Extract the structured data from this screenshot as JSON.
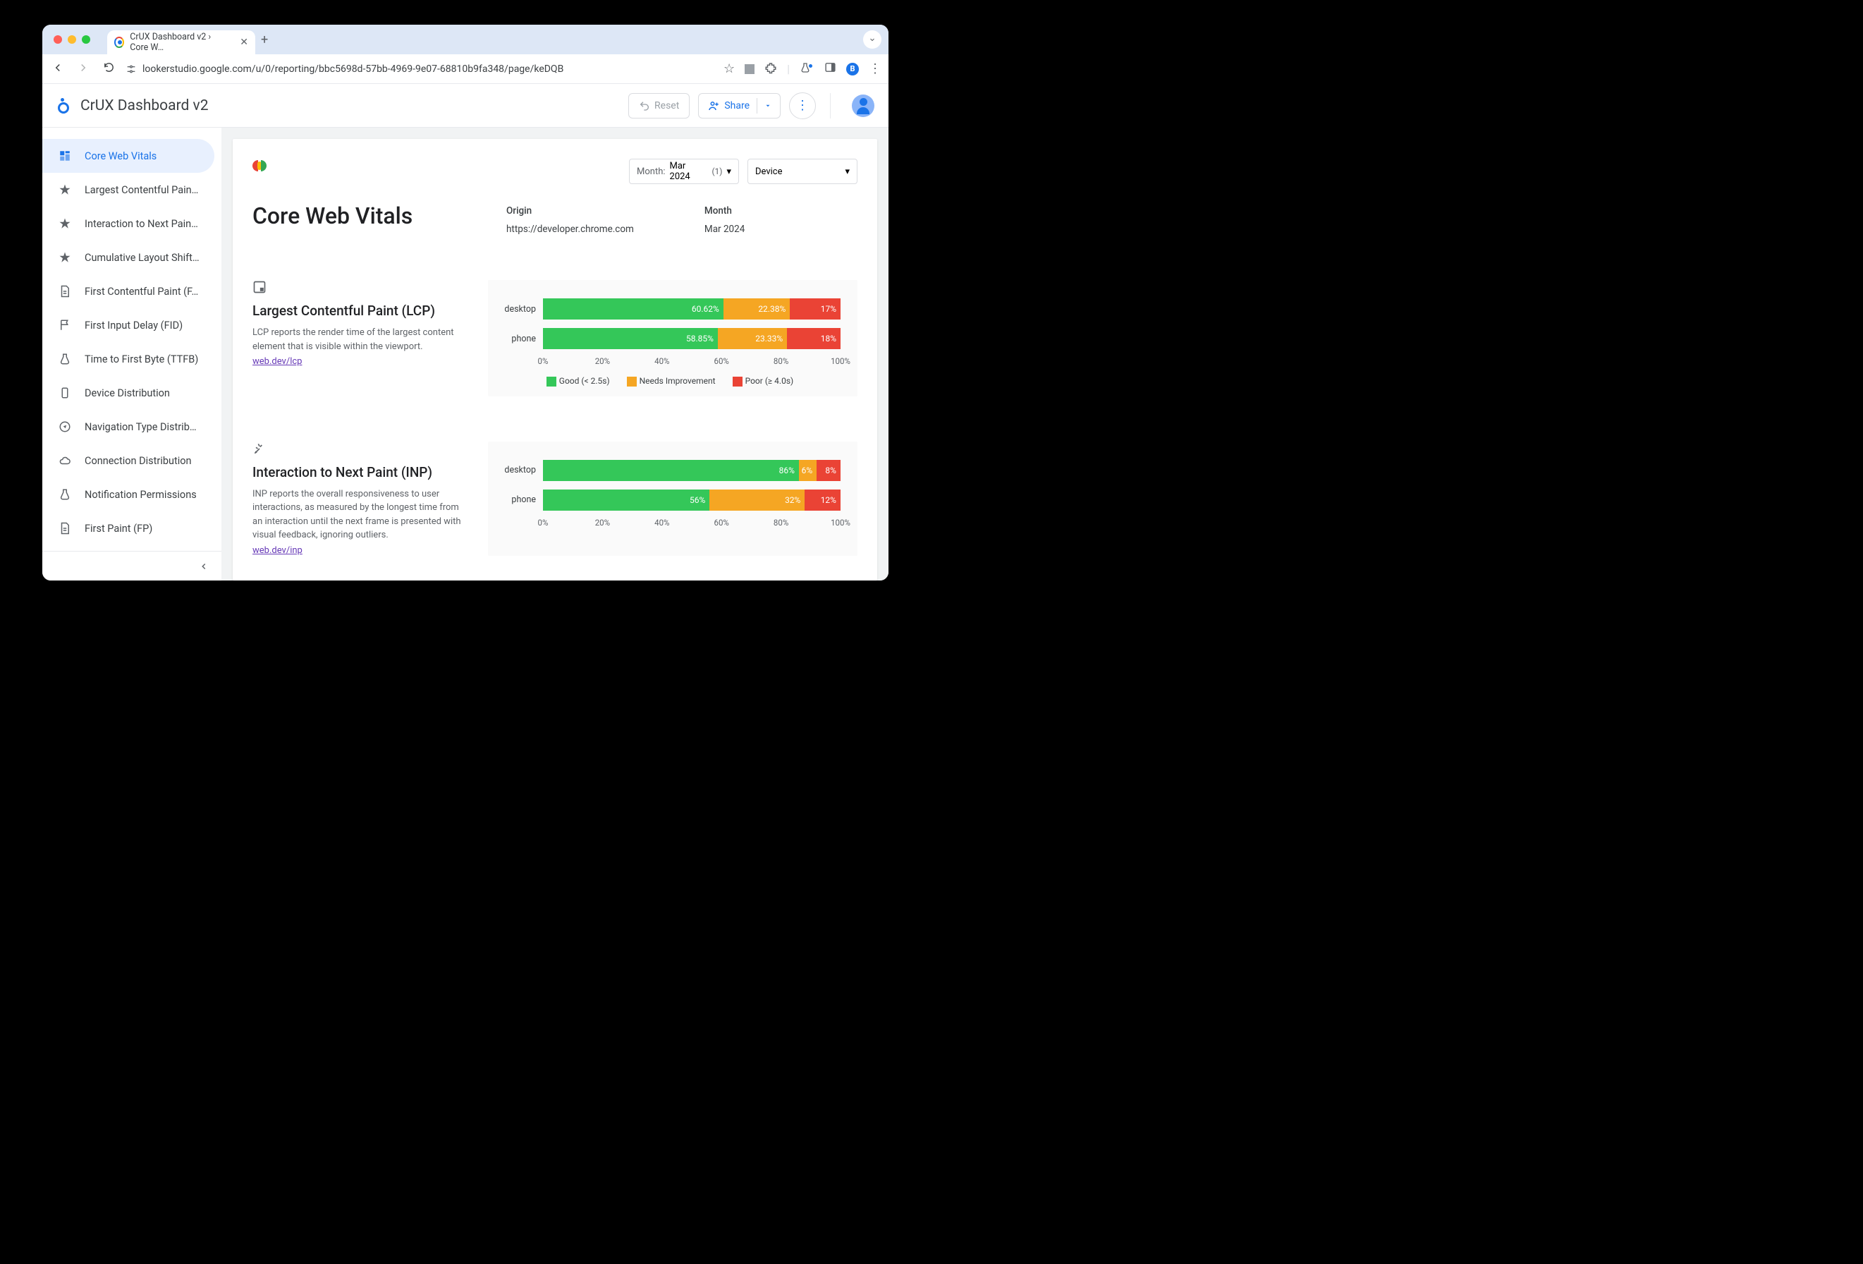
{
  "browser": {
    "tab_title": "CrUX Dashboard v2 › Core W…",
    "url": "lookerstudio.google.com/u/0/reporting/bbc5698d-57bb-4969-9e07-68810b9fa348/page/keDQB",
    "avatar_letter": "B"
  },
  "app": {
    "title": "CrUX Dashboard v2",
    "reset": "Reset",
    "share": "Share"
  },
  "sidebar": {
    "items": [
      {
        "label": "Core Web Vitals",
        "icon": "dashboard",
        "active": true
      },
      {
        "label": "Largest Contentful Pain…",
        "icon": "star"
      },
      {
        "label": "Interaction to Next Pain…",
        "icon": "star"
      },
      {
        "label": "Cumulative Layout Shift…",
        "icon": "star"
      },
      {
        "label": "First Contentful Paint (F…",
        "icon": "doc"
      },
      {
        "label": "First Input Delay (FID)",
        "icon": "flag"
      },
      {
        "label": "Time to First Byte (TTFB)",
        "icon": "flask"
      },
      {
        "label": "Device Distribution",
        "icon": "device"
      },
      {
        "label": "Navigation Type Distrib…",
        "icon": "compass"
      },
      {
        "label": "Connection Distribution",
        "icon": "cloud"
      },
      {
        "label": "Notification Permissions",
        "icon": "flask"
      },
      {
        "label": "First Paint (FP)",
        "icon": "doc"
      }
    ]
  },
  "controls": {
    "month_label": "Month:",
    "month_value": "Mar 2024",
    "month_count": "(1)",
    "device_label": "Device"
  },
  "page": {
    "title": "Core Web Vitals",
    "origin_label": "Origin",
    "origin_value": "https://developer.chrome.com",
    "month_label": "Month",
    "month_value": "Mar 2024"
  },
  "metrics": [
    {
      "title": "Largest Contentful Paint (LCP)",
      "desc": "LCP reports the render time of the largest content element that is visible within the viewport.",
      "link": "web.dev/lcp",
      "chart_ref": 0
    },
    {
      "title": "Interaction to Next Paint (INP)",
      "desc": "INP reports the overall responsiveness to user interactions, as measured by the longest time from an interaction until the next frame is presented with visual feedback, ignoring outliers.",
      "link": "web.dev/inp",
      "chart_ref": 1
    }
  ],
  "legends": {
    "lcp": {
      "good": "Good (< 2.5s)",
      "ni": "Needs Improvement",
      "poor": "Poor (≥ 4.0s)"
    }
  },
  "colors": {
    "good": "#34c759",
    "ni": "#f5a623",
    "poor": "#ea4335"
  },
  "axis_ticks": [
    "0%",
    "20%",
    "40%",
    "60%",
    "80%",
    "100%"
  ],
  "chart_data": [
    {
      "type": "bar",
      "title": "Largest Contentful Paint (LCP)",
      "categories": [
        "desktop",
        "phone"
      ],
      "series": [
        {
          "name": "Good (< 2.5s)",
          "values": [
            60.62,
            58.85
          ]
        },
        {
          "name": "Needs Improvement",
          "values": [
            22.38,
            23.33
          ]
        },
        {
          "name": "Poor (≥ 4.0s)",
          "values": [
            17,
            18
          ]
        }
      ],
      "xlabel": "",
      "ylabel": "",
      "xlim": [
        0,
        100
      ]
    },
    {
      "type": "bar",
      "title": "Interaction to Next Paint (INP)",
      "categories": [
        "desktop",
        "phone"
      ],
      "series": [
        {
          "name": "Good",
          "values": [
            86,
            56
          ]
        },
        {
          "name": "Needs Improvement",
          "values": [
            6,
            32
          ]
        },
        {
          "name": "Poor",
          "values": [
            8,
            12
          ]
        }
      ],
      "xlabel": "",
      "ylabel": "",
      "xlim": [
        0,
        100
      ]
    }
  ]
}
